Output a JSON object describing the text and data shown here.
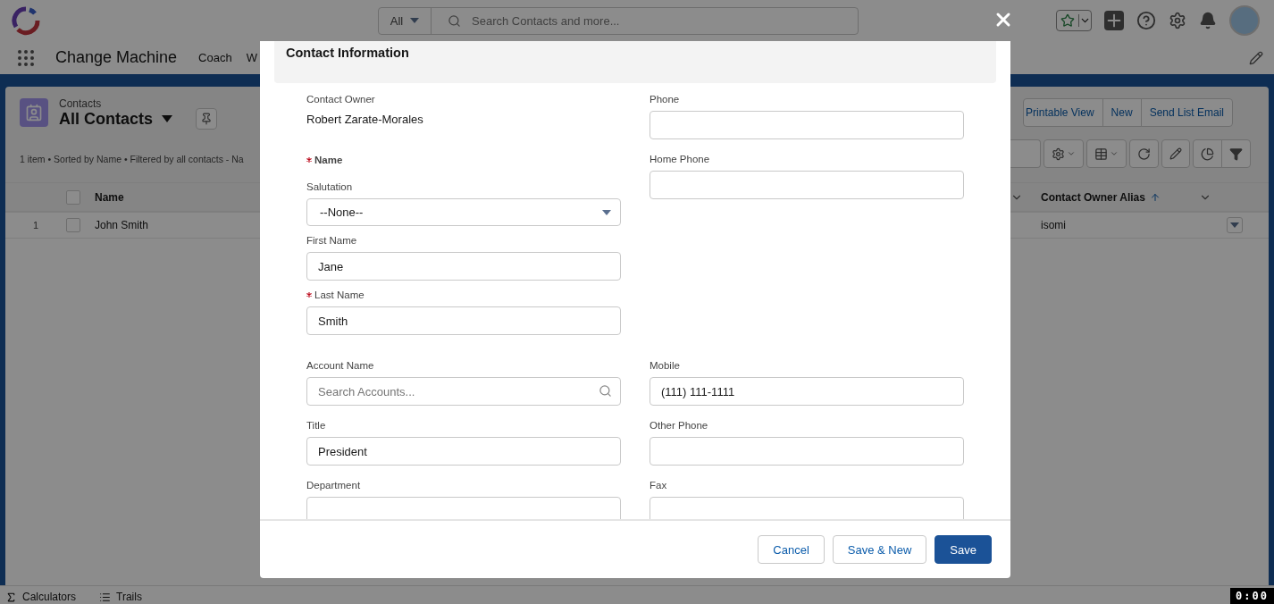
{
  "header": {
    "search_scope": "All",
    "search_placeholder": "Search Contacts and more..."
  },
  "nav": {
    "app_name": "Change Machine",
    "items": [
      {
        "label": "Coach"
      },
      {
        "label": "W"
      }
    ]
  },
  "list_view": {
    "object": "Contacts",
    "title": "All Contacts",
    "summary": "1 item • Sorted by Name • Filtered by all contacts - Na",
    "actions": [
      "Printable View",
      "New",
      "Send List Email"
    ],
    "select_all": {
      "checked": false
    },
    "columns": [
      {
        "label": "Name",
        "sorted": false
      },
      {
        "label": "Contact Owner Alias",
        "sorted": true
      }
    ],
    "rows": [
      {
        "number": "1",
        "name": "John Smith",
        "owner_alias": "isomi",
        "checked": false
      }
    ]
  },
  "modal": {
    "section_title": "Contact Information",
    "owner": {
      "label": "Contact Owner",
      "value": "Robert Zarate-Morales"
    },
    "name_group": {
      "label": "Name",
      "required": true
    },
    "left_fields": [
      {
        "label": "Salutation",
        "kind": "select",
        "value": "--None--",
        "required": false
      },
      {
        "label": "First Name",
        "kind": "input",
        "value": "Jane",
        "required": false
      },
      {
        "label": "Last Name",
        "kind": "input",
        "value": "Smith",
        "required": true
      }
    ],
    "right_fields": [
      {
        "label": "Phone",
        "kind": "input",
        "required": false
      },
      {
        "label": "Home Phone",
        "kind": "input",
        "required": false
      }
    ],
    "lower_fields": [
      {
        "label": "Account Name",
        "kind": "lookup",
        "placeholder": "Search Accounts...",
        "required": false
      },
      {
        "label": "Mobile",
        "kind": "input",
        "value": "(111) 111-1111",
        "required": false
      },
      {
        "label": "Title",
        "kind": "input",
        "value": "President",
        "required": false
      },
      {
        "label": "Other Phone",
        "kind": "input",
        "required": false
      },
      {
        "label": "Department",
        "kind": "input",
        "required": false
      },
      {
        "label": "Fax",
        "kind": "input",
        "required": false
      }
    ],
    "buttons": [
      {
        "label": "Cancel",
        "kind": "neutral"
      },
      {
        "label": "Save & New",
        "kind": "neutral"
      },
      {
        "label": "Save",
        "kind": "brand"
      }
    ]
  },
  "utility_bar": [
    {
      "label": "Calculators",
      "kind": "sigma"
    },
    {
      "label": "Trails",
      "kind": "list"
    }
  ],
  "recording_timer": "0:00"
}
